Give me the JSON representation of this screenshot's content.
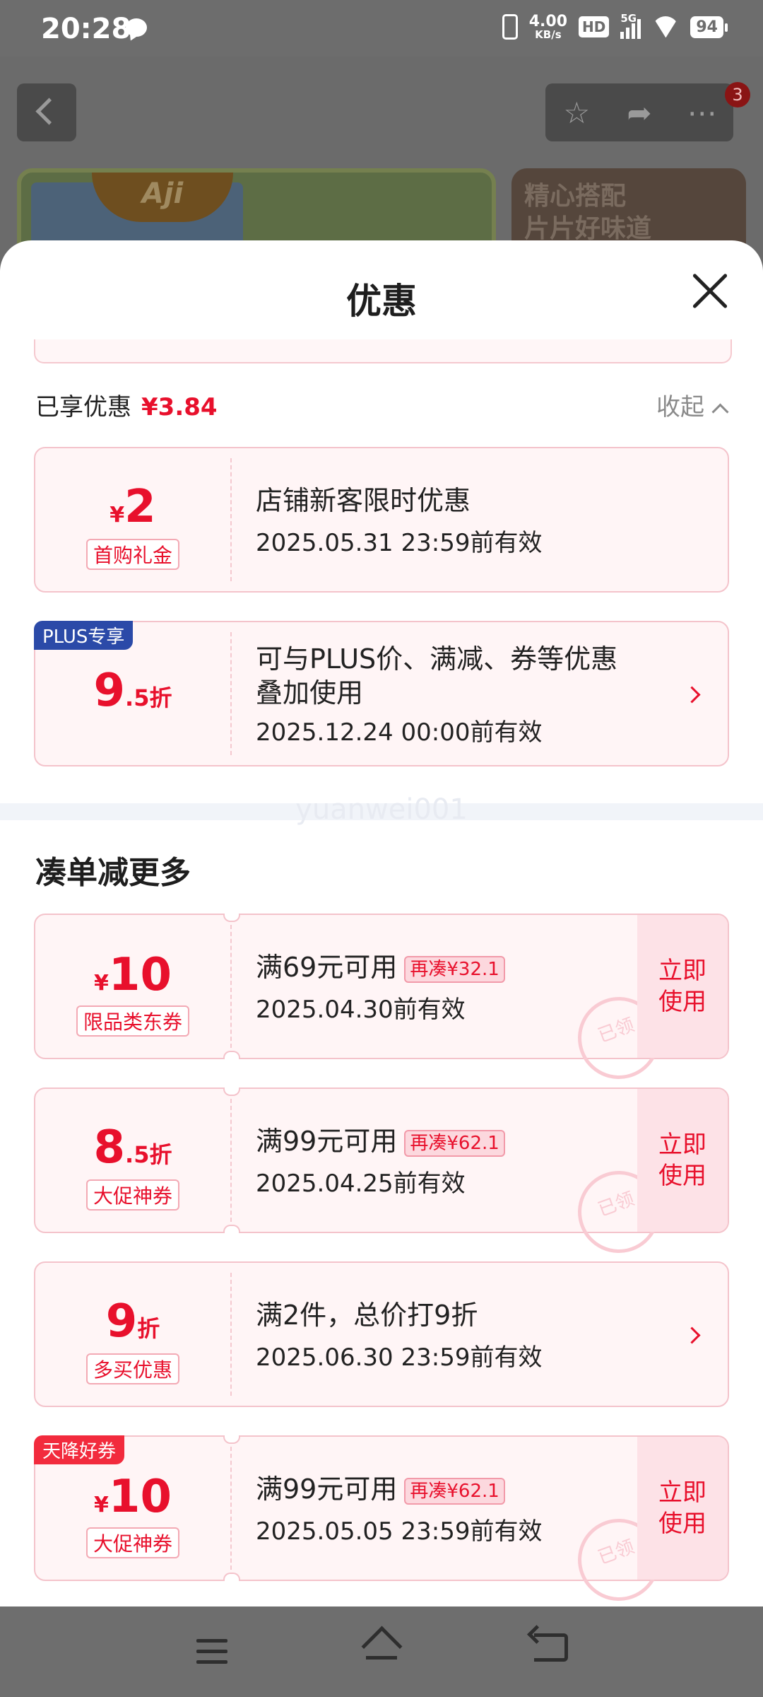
{
  "status_bar": {
    "time": "20:28",
    "speed_value": "4.00",
    "speed_unit": "KB/s",
    "hd": "HD",
    "network": "5G",
    "battery": "94"
  },
  "background": {
    "badge_count": "3",
    "brand_logo": "Aji",
    "banner_right_line1": "精心搭配",
    "banner_right_line2": "片片好味道"
  },
  "sheet": {
    "title": "优惠",
    "enjoyed_label": "已享优惠",
    "enjoyed_amount": "¥3.84",
    "collapse_label": "收起",
    "enjoyed_items": [
      {
        "yen": "¥",
        "value": "2",
        "unit": "",
        "tag": "首购礼金",
        "ribbon": "",
        "title": "店铺新客限时优惠",
        "validity": "2025.05.31 23:59前有效"
      },
      {
        "yen": "",
        "value": "9",
        "unit": ".5折",
        "tag": "",
        "ribbon": "PLUS专享",
        "title_line1": "可与PLUS价、满减、券等优惠",
        "title_line2": "叠加使用",
        "validity": "2025.12.24 00:00前有效"
      }
    ],
    "watermark": "yuanwei001",
    "section_title": "凑单减更多",
    "more_items": [
      {
        "yen": "¥",
        "value": "10",
        "unit": "",
        "tag": "限品类东券",
        "ribbon": "",
        "title": "满69元可用",
        "more_tag": "再凑¥32.1",
        "validity": "2025.04.30前有效",
        "action_line1": "立即",
        "action_line2": "使用",
        "stamp": "已领"
      },
      {
        "yen": "",
        "value": "8",
        "unit": ".5折",
        "tag": "大促神券",
        "ribbon": "",
        "title": "满99元可用",
        "more_tag": "再凑¥62.1",
        "validity": "2025.04.25前有效",
        "action_line1": "立即",
        "action_line2": "使用",
        "stamp": "已领"
      },
      {
        "yen": "",
        "value": "9",
        "unit": "折",
        "tag": "多买优惠",
        "ribbon": "",
        "title": "满2件，总价打9折",
        "validity": "2025.06.30 23:59前有效"
      },
      {
        "yen": "¥",
        "value": "10",
        "unit": "",
        "tag": "大促神券",
        "ribbon": "天降好券",
        "title": "满99元可用",
        "more_tag": "再凑¥62.1",
        "validity": "2025.05.05 23:59前有效",
        "action_line1": "立即",
        "action_line2": "使用",
        "stamp": "已领"
      }
    ]
  },
  "colors": {
    "accent": "#e8102c",
    "card_bg": "#fff5f6",
    "card_border": "#f4c3cb",
    "plus_blue": "#2b4aa8"
  }
}
